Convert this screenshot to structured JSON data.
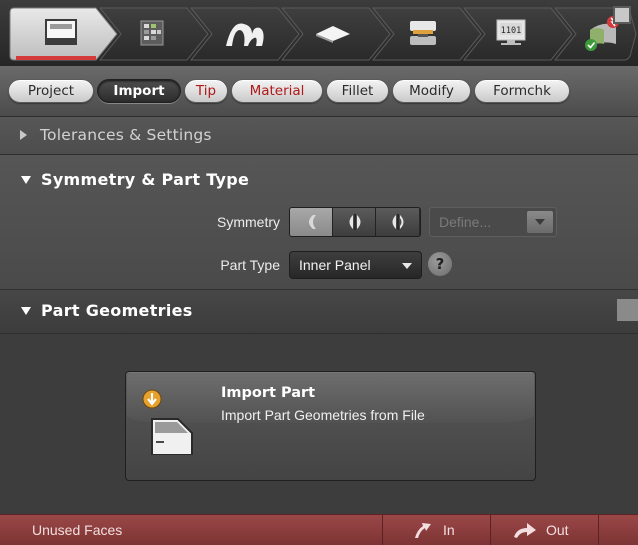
{
  "workflow_steps": [
    {
      "icon": "part-screen-icon",
      "active": true
    },
    {
      "icon": "grid-mesh-icon",
      "active": false
    },
    {
      "icon": "profile-arch-icon",
      "active": false
    },
    {
      "icon": "flat-surface-icon",
      "active": false
    },
    {
      "icon": "die-press-icon",
      "active": false
    },
    {
      "icon": "binary-monitor-icon",
      "active": false
    },
    {
      "icon": "result-check-icon",
      "active": false
    }
  ],
  "step_labels": {
    "binary_code": "1101"
  },
  "tabs": [
    {
      "label": "Project",
      "active": false,
      "warning": false
    },
    {
      "label": "Import",
      "active": true,
      "warning": false
    },
    {
      "label": "Tip",
      "active": false,
      "warning": true
    },
    {
      "label": "Material",
      "active": false,
      "warning": true
    },
    {
      "label": "Fillet",
      "active": false,
      "warning": false
    },
    {
      "label": "Modify",
      "active": false,
      "warning": false
    },
    {
      "label": "Formchk",
      "active": false,
      "warning": false
    }
  ],
  "sections": {
    "tolerances": {
      "title": "Tolerances & Settings",
      "expanded": false
    },
    "symmetry": {
      "title": "Symmetry & Part Type",
      "expanded": true,
      "symmetry_label": "Symmetry",
      "symmetry_options": [
        "none",
        "half-symmetric",
        "full-symmetric"
      ],
      "symmetry_selected": "none",
      "define_label": "Define...",
      "define_enabled": false,
      "part_type_label": "Part Type",
      "part_type_value": "Inner Panel",
      "help_glyph": "?"
    },
    "geometries": {
      "title": "Part Geometries",
      "expanded": true
    }
  },
  "import_card": {
    "title": "Import Part",
    "subtitle": "Import Part Geometries from File",
    "icon": "import-door-icon"
  },
  "footer": {
    "status_label": "Unused Faces",
    "in_label": "In",
    "out_label": "Out",
    "color": "#8a3c3c"
  },
  "colors": {
    "active_step_accent": "#d43a3a",
    "warning_text": "#b0191a",
    "panel_bg": "#4f4f4f"
  }
}
